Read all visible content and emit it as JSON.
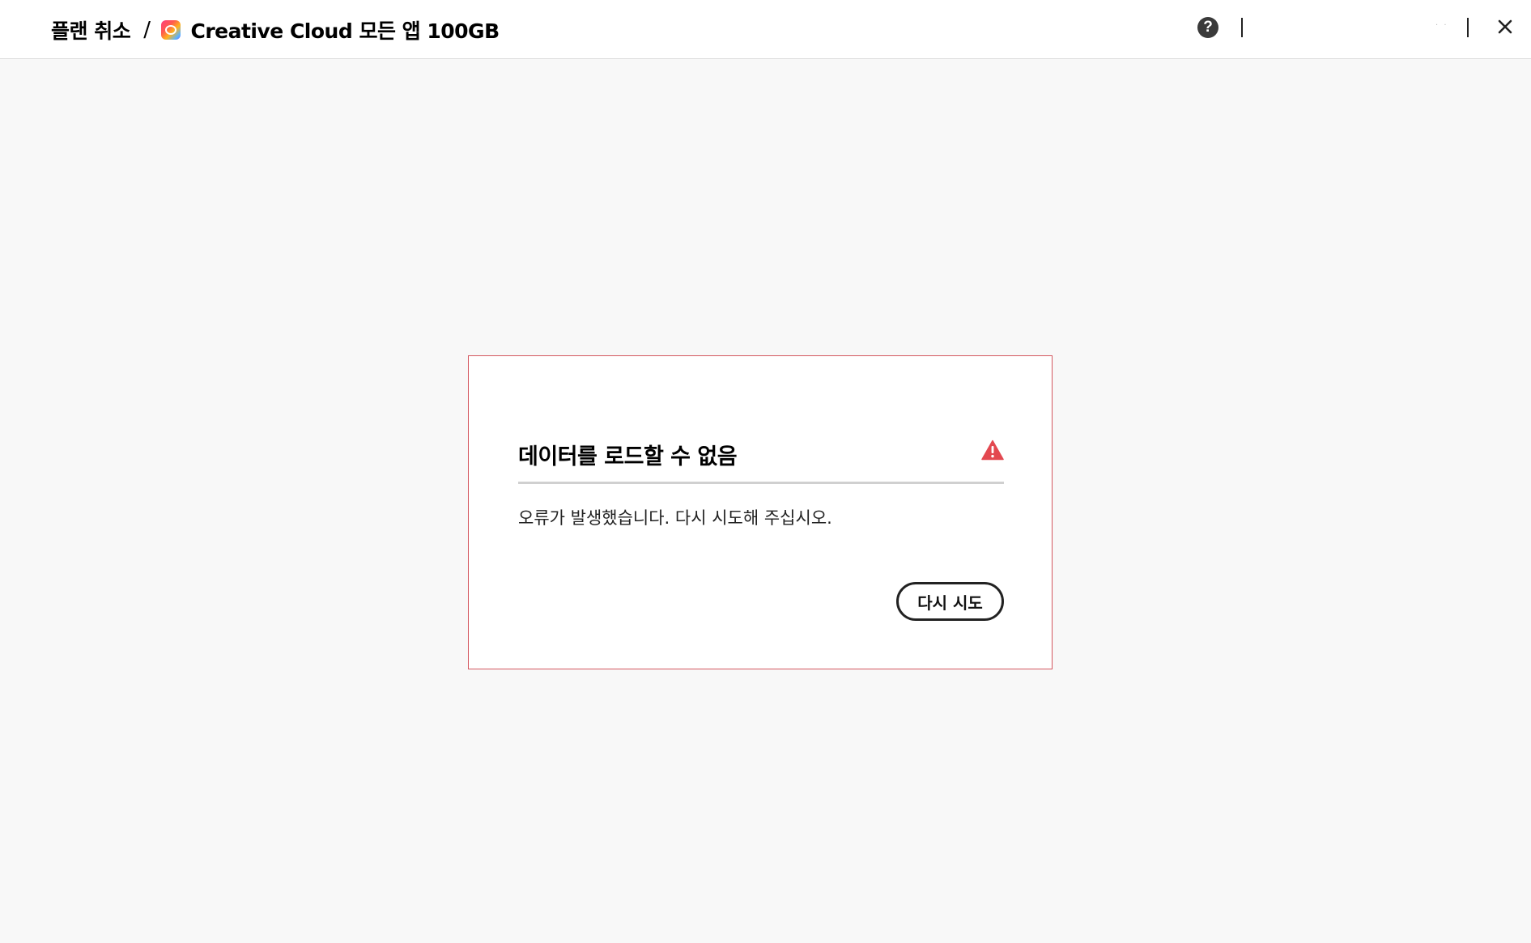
{
  "header": {
    "breadcrumb_root": "플랜 취소",
    "separator": "/",
    "product_name": "Creative Cloud 모든 앱 100GB",
    "product_icon": "creative-cloud-logo",
    "help_icon": "question-circle-icon",
    "help_glyph": "?",
    "close_icon": "close-icon",
    "overflow_text": "· ·"
  },
  "error": {
    "title": "데이터를 로드할 수 없음",
    "icon": "warning-triangle-icon",
    "icon_color": "#e34850",
    "message": "오류가 발생했습니다. 다시 시도해 주십시오.",
    "retry_label": "다시 시도"
  },
  "colors": {
    "page_background": "#f8f8f8",
    "card_border": "#d4575f",
    "warning": "#e34850"
  }
}
